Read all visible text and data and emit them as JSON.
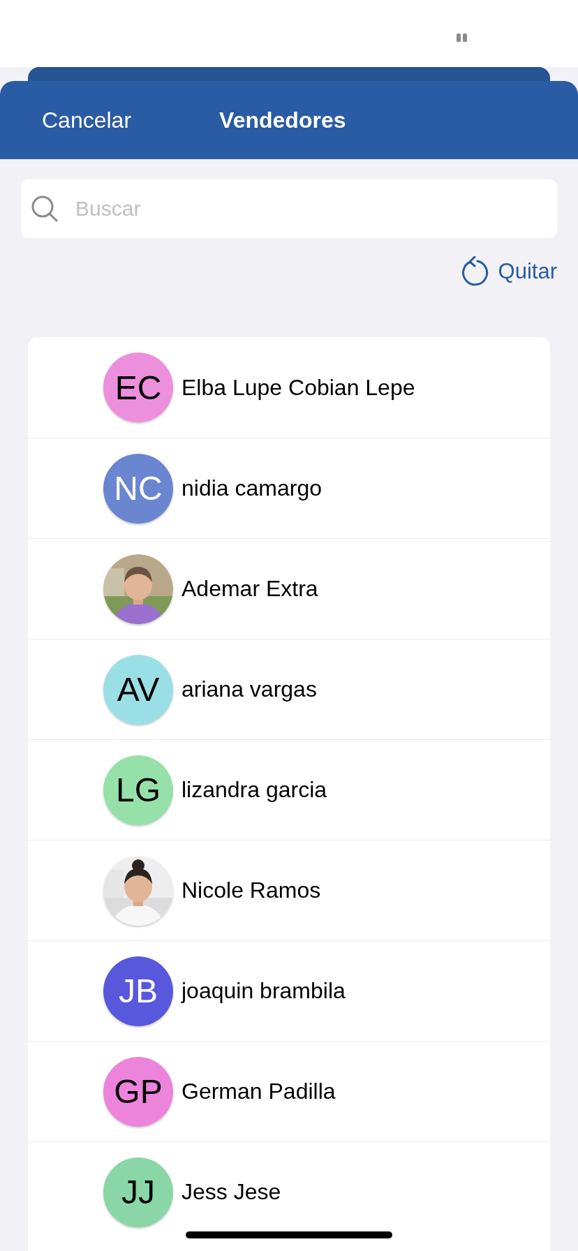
{
  "header": {
    "cancel": "Cancelar",
    "title": "Vendedores"
  },
  "search": {
    "placeholder": "Buscar"
  },
  "clear_button": {
    "label": "Quitar"
  },
  "sellers": [
    {
      "kind": "initials",
      "initials": "EC",
      "color": "#ec8fdc",
      "name": "Elba Lupe Cobian Lepe"
    },
    {
      "kind": "initials",
      "initials": "NC",
      "color": "#6b86d0",
      "name": "nidia camargo"
    },
    {
      "kind": "picture",
      "name": "Ademar Extra"
    },
    {
      "kind": "initials",
      "initials": "AV",
      "color": "#9bdfe6",
      "name": "ariana vargas"
    },
    {
      "kind": "initials",
      "initials": "LG",
      "color": "#96e1aa",
      "name": "lizandra garcia"
    },
    {
      "kind": "picture",
      "name": "Nicole Ramos"
    },
    {
      "kind": "initials",
      "initials": "JB",
      "color": "#5858dc",
      "name": "joaquin brambila"
    },
    {
      "kind": "initials",
      "initials": "GP",
      "color": "#ec84dc",
      "name": "German Padilla"
    },
    {
      "kind": "initials",
      "initials": "JJ",
      "color": "#8ad6a6",
      "name": "Jess Jese"
    }
  ]
}
